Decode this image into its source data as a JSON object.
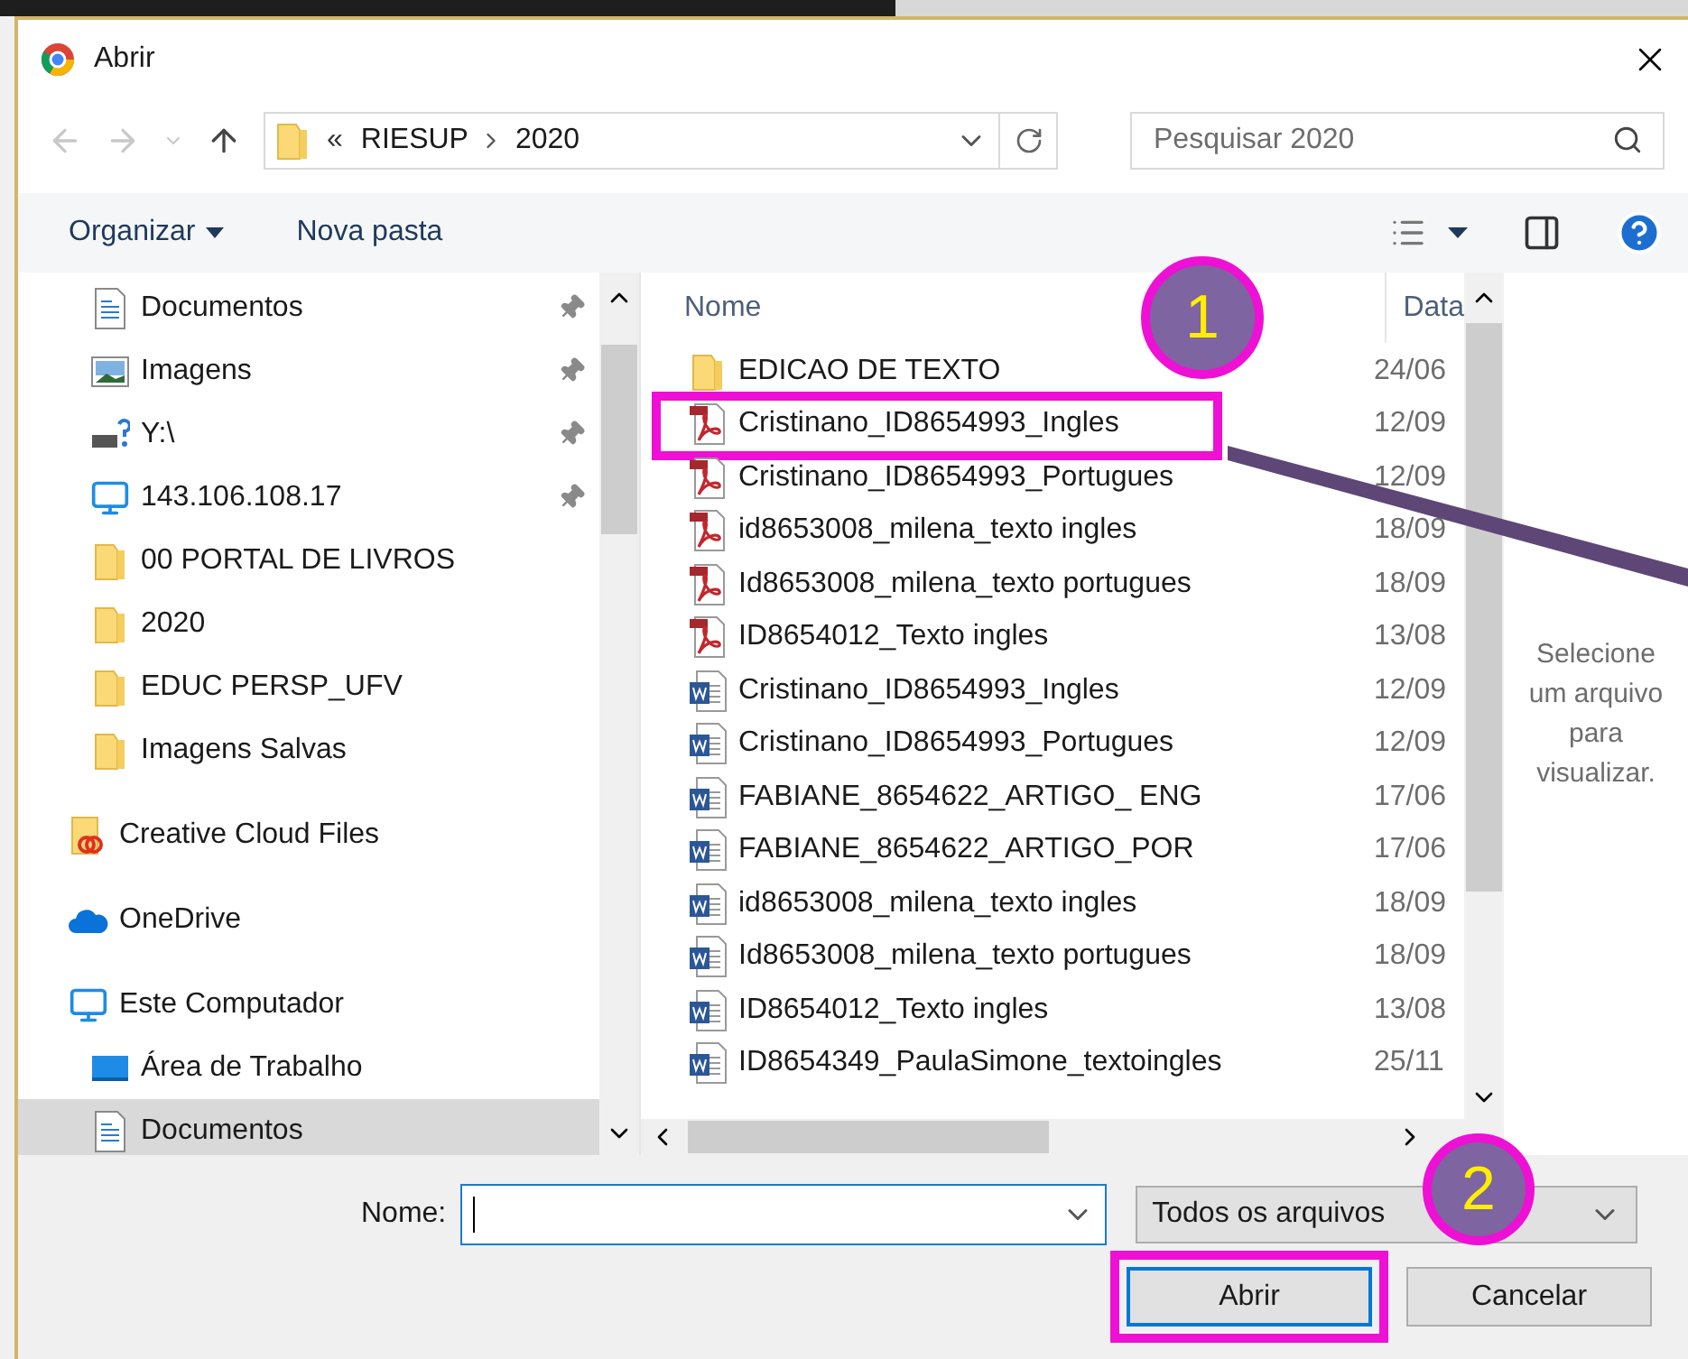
{
  "window": {
    "title": "Abrir"
  },
  "nav": {
    "overflow": "«",
    "crumbs": [
      "RIESUP",
      "2020"
    ]
  },
  "search": {
    "placeholder": "Pesquisar 2020"
  },
  "toolbar": {
    "organize": "Organizar",
    "new_folder": "Nova pasta"
  },
  "sidebar": {
    "quick_access": [
      {
        "label": "Documentos",
        "kind": "documents",
        "pinned": true
      },
      {
        "label": "Imagens",
        "kind": "pictures",
        "pinned": true
      },
      {
        "label": "Y:\\",
        "kind": "drive",
        "pinned": true
      },
      {
        "label": "143.106.108.17",
        "kind": "computer",
        "pinned": true
      },
      {
        "label": "00 PORTAL DE LIVROS",
        "kind": "folder",
        "pinned": false
      },
      {
        "label": "2020",
        "kind": "folder",
        "pinned": false
      },
      {
        "label": "EDUC PERSP_UFV",
        "kind": "folder",
        "pinned": false
      },
      {
        "label": "Imagens Salvas",
        "kind": "folder",
        "pinned": false
      }
    ],
    "roots": [
      {
        "label": "Creative Cloud Files",
        "kind": "cloudfolder",
        "selected": false
      },
      {
        "label": "OneDrive",
        "kind": "onedrive",
        "selected": false
      },
      {
        "label": "Este Computador",
        "kind": "computer",
        "selected": false,
        "children": [
          {
            "label": "Área de Trabalho",
            "kind": "desktop",
            "selected": false
          },
          {
            "label": "Documentos",
            "kind": "documents",
            "selected": true
          }
        ]
      }
    ]
  },
  "columns": [
    "Nome",
    "Data"
  ],
  "files": [
    {
      "name": "EDICAO DE TEXTO",
      "date": "24/06",
      "kind": "folder",
      "highlighted": false
    },
    {
      "name": "Cristinano_ID8654993_Ingles",
      "date": "12/09",
      "kind": "pdf",
      "highlighted": true
    },
    {
      "name": "Cristinano_ID8654993_Portugues",
      "date": "12/09",
      "kind": "pdf",
      "highlighted": false
    },
    {
      "name": "id8653008_milena_texto ingles",
      "date": "18/09",
      "kind": "pdf",
      "highlighted": false
    },
    {
      "name": "Id8653008_milena_texto portugues",
      "date": "18/09",
      "kind": "pdf",
      "highlighted": false
    },
    {
      "name": "ID8654012_Texto ingles",
      "date": "13/08",
      "kind": "pdf",
      "highlighted": false
    },
    {
      "name": "Cristinano_ID8654993_Ingles",
      "date": "12/09",
      "kind": "word",
      "highlighted": false
    },
    {
      "name": "Cristinano_ID8654993_Portugues",
      "date": "12/09",
      "kind": "word",
      "highlighted": false
    },
    {
      "name": "FABIANE_8654622_ARTIGO_ ENG",
      "date": "17/06",
      "kind": "word",
      "highlighted": false
    },
    {
      "name": "FABIANE_8654622_ARTIGO_POR",
      "date": "17/06",
      "kind": "word",
      "highlighted": false
    },
    {
      "name": "id8653008_milena_texto ingles",
      "date": "18/09",
      "kind": "word",
      "highlighted": false
    },
    {
      "name": "Id8653008_milena_texto portugues",
      "date": "18/09",
      "kind": "word",
      "highlighted": false
    },
    {
      "name": "ID8654012_Texto ingles",
      "date": "13/08",
      "kind": "word",
      "highlighted": false
    },
    {
      "name": "ID8654349_PaulaSimone_textoingles",
      "date": "25/11",
      "kind": "word",
      "highlighted": false
    }
  ],
  "preview": "Selecione um arquivo para visualizar.",
  "filename": {
    "label": "Nome:"
  },
  "filter": "Todos os arquivos",
  "buttons": [
    {
      "label": "Abrir",
      "highlighted": true
    },
    {
      "label": "Cancelar",
      "highlighted": false
    }
  ],
  "annotations": [
    {
      "label": "1"
    },
    {
      "label": "2"
    }
  ]
}
